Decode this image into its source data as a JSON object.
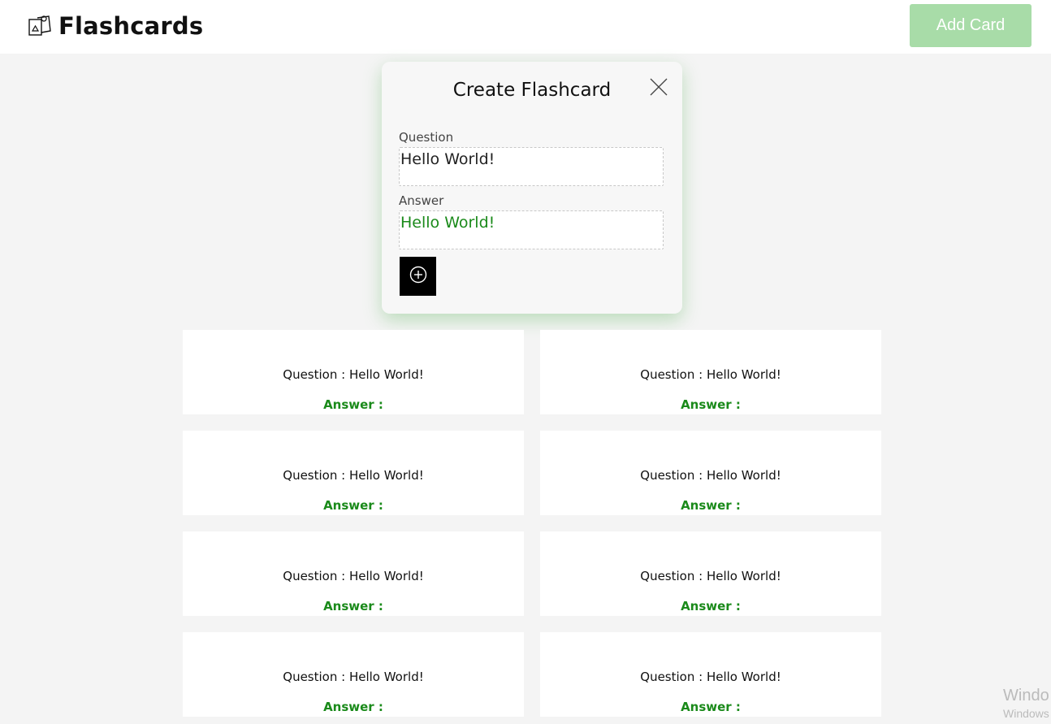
{
  "header": {
    "title": "Flashcards",
    "logo_icon": "flashcards-icon",
    "add_card_label": "Add Card",
    "add_card_color": "#a8dca8"
  },
  "modal": {
    "title": "Create Flashcard",
    "close_icon": "close-icon",
    "question_label": "Question",
    "question_value": "Hello World!",
    "answer_label": "Answer",
    "answer_value": "Hello World!",
    "submit_icon": "plus-circle-icon"
  },
  "cards": [
    {
      "question": "Question : Hello World!",
      "answer": "Answer :"
    },
    {
      "question": "Question : Hello World!",
      "answer": "Answer :"
    },
    {
      "question": "Question : Hello World!",
      "answer": "Answer :"
    },
    {
      "question": "Question : Hello World!",
      "answer": "Answer :"
    },
    {
      "question": "Question : Hello World!",
      "answer": "Answer :"
    },
    {
      "question": "Question : Hello World!",
      "answer": "Answer :"
    },
    {
      "question": "Question : Hello World!",
      "answer": "Answer :"
    },
    {
      "question": "Question : Hello World!",
      "answer": "Answer :"
    }
  ],
  "colors": {
    "answer_green": "#1a8a1a",
    "background": "#f4f4f4"
  },
  "watermark": {
    "line1": "Windo",
    "line2": "Windows"
  }
}
